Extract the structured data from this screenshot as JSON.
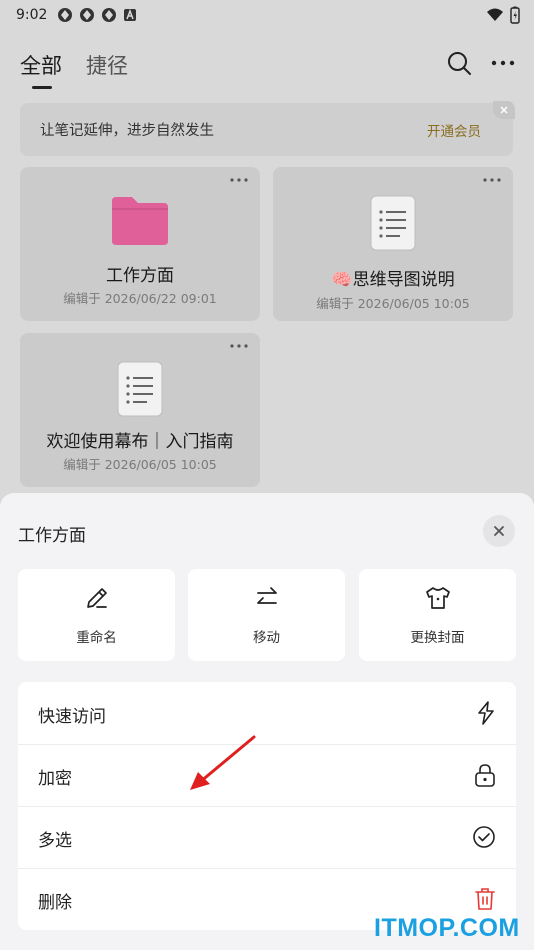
{
  "status_bar": {
    "time": "9:02"
  },
  "header": {
    "tabs": [
      {
        "label": "全部",
        "active": true
      },
      {
        "label": "捷径",
        "active": false
      }
    ]
  },
  "banner": {
    "text": "让笔记延伸，进步自然发生",
    "action": "开通会员"
  },
  "cards": [
    {
      "title": "工作方面",
      "date": "编辑于 2026/06/22 09:01",
      "icon": "folder-icon"
    },
    {
      "title": "🧠思维导图说明",
      "date": "编辑于 2026/06/05 10:05",
      "icon": "document-icon"
    },
    {
      "title": "欢迎使用幕布｜入门指南",
      "date": "编辑于 2026/06/05 10:05",
      "icon": "document-icon"
    }
  ],
  "sheet": {
    "title": "工作方面",
    "actions": [
      {
        "label": "重命名",
        "icon": "pencil-icon"
      },
      {
        "label": "移动",
        "icon": "swap-arrows-icon"
      },
      {
        "label": "更换封面",
        "icon": "shirt-icon"
      }
    ],
    "menu": [
      {
        "label": "快速访问",
        "icon": "lightning-icon"
      },
      {
        "label": "加密",
        "icon": "lock-icon"
      },
      {
        "label": "多选",
        "icon": "check-circle-icon"
      },
      {
        "label": "删除",
        "icon": "trash-icon"
      }
    ]
  },
  "colors": {
    "folder": "#e0609a",
    "delete": "#e53935",
    "banner_action": "#8a6d20",
    "watermark": "#1ba0e2",
    "annotation_arrow": "#e02020"
  },
  "watermark": "ITMOP.COM"
}
